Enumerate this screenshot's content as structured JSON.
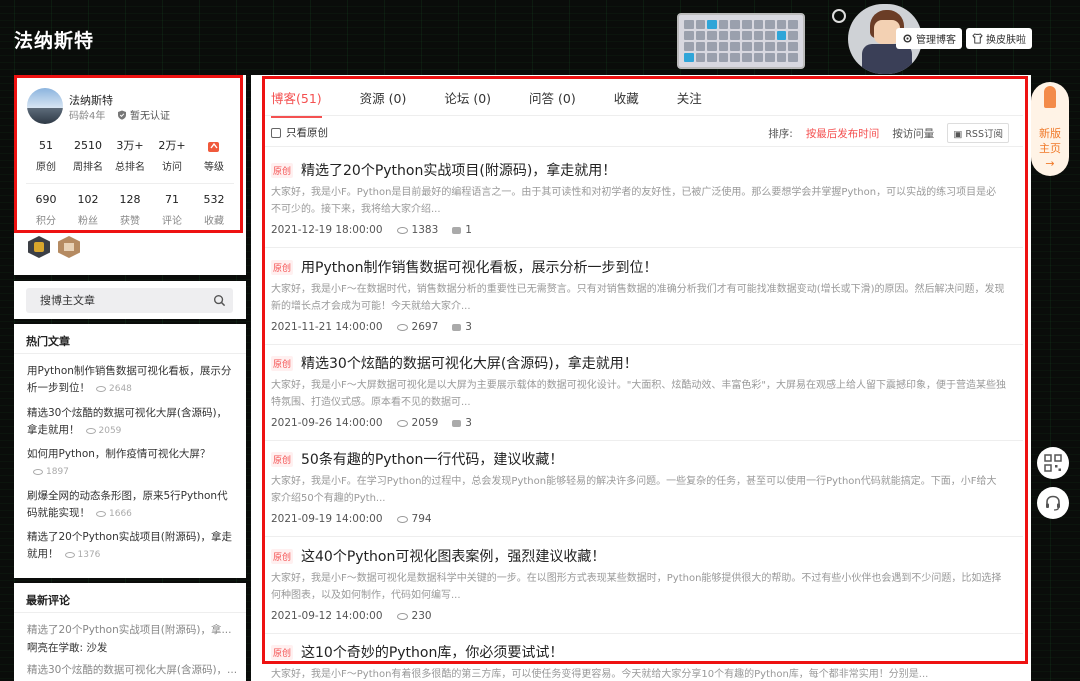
{
  "header": {
    "blog_title": "法纳斯特",
    "manage_label": "管理博客",
    "skin_label": "换皮肤啦"
  },
  "profile": {
    "name": "法纳斯特",
    "code_age": "码龄4年",
    "auth": "暂无认证",
    "stats_row1": [
      {
        "value": "51",
        "label": "原创"
      },
      {
        "value": "2510",
        "label": "周排名"
      },
      {
        "value": "3万+",
        "label": "总排名"
      },
      {
        "value": "2万+",
        "label": "访问"
      },
      {
        "value": "",
        "label": "等级"
      }
    ],
    "stats_row2": [
      {
        "value": "690",
        "label": "积分"
      },
      {
        "value": "102",
        "label": "粉丝"
      },
      {
        "value": "128",
        "label": "获赞"
      },
      {
        "value": "71",
        "label": "评论"
      },
      {
        "value": "532",
        "label": "收藏"
      }
    ]
  },
  "search": {
    "placeholder": "搜博主文章"
  },
  "hot": {
    "title": "热门文章",
    "items": [
      {
        "title": "用Python制作销售数据可视化看板，展示分析一步到位！",
        "views": "2648"
      },
      {
        "title": "精选30个炫酷的数据可视化大屏(含源码)，拿走就用！",
        "views": "2059"
      },
      {
        "title": "如何用Python，制作疫情可视化大屏？",
        "views": "1897"
      },
      {
        "title": "刷爆全网的动态条形图，原来5行Python代码就能实现！",
        "views": "1666"
      },
      {
        "title": "精选了20个Python实战项目(附源码)，拿走就用！",
        "views": "1376"
      }
    ]
  },
  "comments": {
    "title": "最新评论",
    "items": [
      {
        "text": "精选了20个Python实战项目(附源码)，拿...",
        "style": "a"
      },
      {
        "text": "啊亮在学敢: 沙发",
        "style": "b"
      },
      {
        "text": "精选30个炫酷的数据可视化大屏(含源码)，...",
        "style": "a"
      }
    ]
  },
  "tabs": [
    {
      "label": "博客(51)",
      "active": true
    },
    {
      "label": "资源 (0)",
      "active": false
    },
    {
      "label": "论坛 (0)",
      "active": false
    },
    {
      "label": "问答 (0)",
      "active": false
    },
    {
      "label": "收藏",
      "active": false
    },
    {
      "label": "关注",
      "active": false
    }
  ],
  "filter": {
    "origin_only": "只看原创",
    "sort_label": "排序:",
    "sort_time": "按最后发布时间",
    "sort_views": "按访问量",
    "rss": "RSS订阅"
  },
  "articles": [
    {
      "tag": "原创",
      "title": "精选了20个Python实战项目(附源码)，拿走就用！",
      "abstract": "大家好，我是小F。Python是目前最好的编程语言之一。由于其可读性和对初学者的友好性，已被广泛使用。那么要想学会并掌握Python，可以实战的练习项目是必不可少的。接下来，我将给大家介绍...",
      "date": "2021-12-19 18:00:00",
      "views": "1383",
      "comments": "1"
    },
    {
      "tag": "原创",
      "title": "用Python制作销售数据可视化看板，展示分析一步到位！",
      "abstract": "大家好，我是小F～在数据时代，销售数据分析的重要性已无需赘言。只有对销售数据的准确分析我们才有可能找准数据变动(增长或下滑)的原因。然后解决问题，发现新的增长点才会成为可能！今天就给大家介...",
      "date": "2021-11-21 14:00:00",
      "views": "2697",
      "comments": "3"
    },
    {
      "tag": "原创",
      "title": "精选30个炫酷的数据可视化大屏(含源码)，拿走就用！",
      "abstract": "大家好，我是小F～大屏数据可视化是以大屏为主要展示载体的数据可视化设计。\"大面积、炫酷动效、丰富色彩\"，大屏易在观感上给人留下震撼印象，便于营造某些独特氛围、打造仪式感。原本看不见的数据可...",
      "date": "2021-09-26 14:00:00",
      "views": "2059",
      "comments": "3"
    },
    {
      "tag": "原创",
      "title": "50条有趣的Python一行代码，建议收藏！",
      "abstract": "大家好，我是小F。在学习Python的过程中，总会发现Python能够轻易的解决许多问题。一些复杂的任务，甚至可以使用一行Python代码就能搞定。下面，小F给大家介绍50个有趣的Pyth...",
      "date": "2021-09-19 14:00:00",
      "views": "794",
      "comments": ""
    },
    {
      "tag": "原创",
      "title": "这40个Python可视化图表案例，强烈建议收藏！",
      "abstract": "大家好，我是小F～数据可视化是数据科学中关键的一步。在以图形方式表现某些数据时，Python能够提供很大的帮助。不过有些小伙伴也会遇到不少问题，比如选择何种图表，以及如何制作，代码如何编写...",
      "date": "2021-09-12 14:00:00",
      "views": "230",
      "comments": ""
    },
    {
      "tag": "原创",
      "title": "这10个奇妙的Python库，你必须要试试！",
      "abstract": "大家好，我是小F～Python有着很多很酷的第三方库，可以使任务变得更容易。今天就给大家分享10个有趣的Python库，每个都非常实用！分别是...",
      "date": "",
      "views": "",
      "comments": ""
    }
  ],
  "floating": {
    "rocket_label_1": "新版",
    "rocket_label_2": "主页"
  },
  "colors": {
    "accent": "#f45050",
    "highlight_box": "#ee1111",
    "background": "#0a0c0a"
  }
}
